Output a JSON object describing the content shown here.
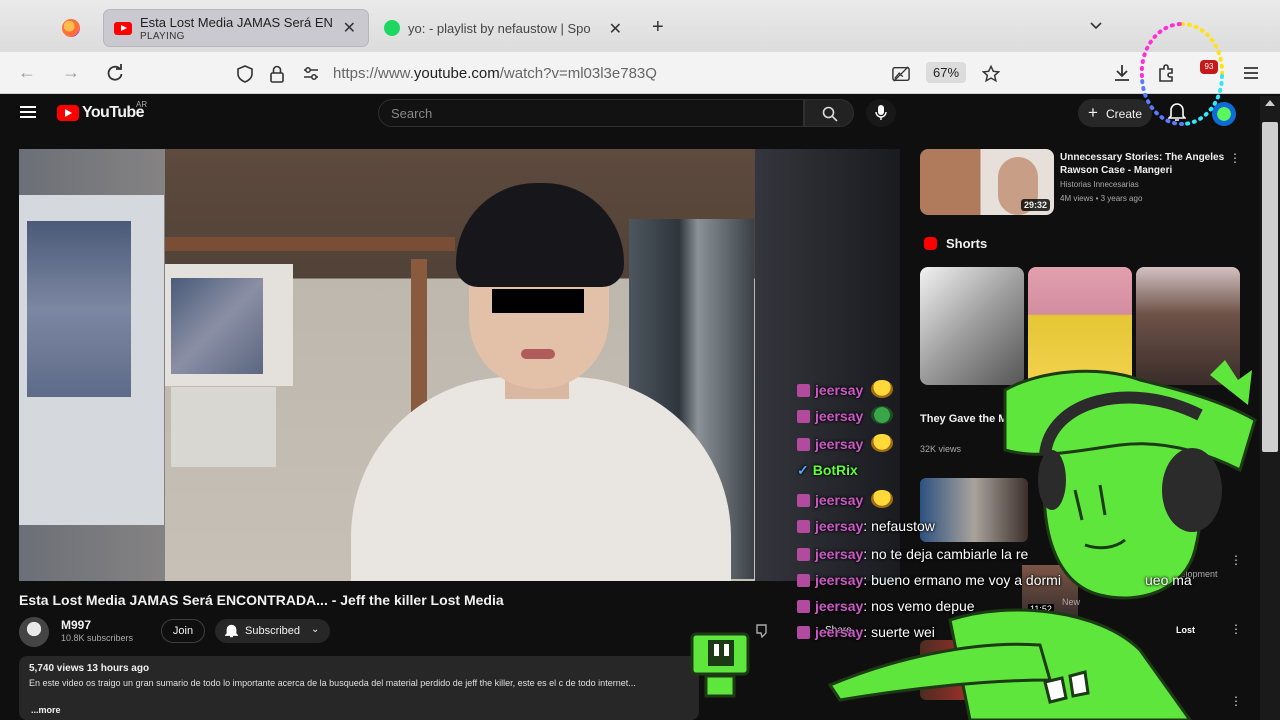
{
  "browser": {
    "tabs": [
      {
        "title": "Esta Lost Media JAMAS Será EN",
        "subtitle": "PLAYING",
        "active": true
      },
      {
        "title": "yo: - playlist by nefaustow | Spo",
        "active": false
      }
    ],
    "url_prefix": "https://www.",
    "url_domain": "youtube.com",
    "url_path": "/watch?v=ml03l3e783Q",
    "zoom": "67%",
    "extension_badge": "93"
  },
  "youtube": {
    "wordmark": "YouTube",
    "country": "AR",
    "search_placeholder": "Search",
    "create_label": "Create"
  },
  "video": {
    "title": "Esta Lost Media JAMAS Será ENCONTRADA... - Jeff the killer Lost Media",
    "channel": "M997",
    "subscribers": "10.8K subscribers",
    "join_label": "Join",
    "subscribed_label": "Subscribed",
    "stats": "5,740 views  13 hours ago",
    "description": "En este video os traigo un gran sumario de todo lo importante acerca de la busqueda del material perdido de jeff the killer, este es el c de todo internet...",
    "more_label": "...more",
    "share_label": "Share"
  },
  "sidebar": {
    "rec1": {
      "title": "Unnecessary Stories: The Angeles Rawson Case - Mangeri",
      "channel": "Historias Innecesarias",
      "meta": "4M views • 3 years ago",
      "duration": "29:32"
    },
    "shorts_label": "Shorts",
    "short_title": "They Gave the Mouse ...",
    "short_views": "32K views",
    "rec_frag_development": "development",
    "rec_frag_lost": "Lost",
    "rec_frag_new": "New",
    "rec_frag_duration": "11:52"
  },
  "chat": {
    "messages": [
      {
        "user": "jeersay",
        "text": ""
      },
      {
        "user": "jeersay",
        "text": ""
      },
      {
        "user": "jeersay",
        "text": ""
      },
      {
        "user": "BotRix",
        "text": ""
      },
      {
        "user": "jeersay",
        "text": ""
      },
      {
        "user": "jeersay",
        "text": "nefaustow"
      },
      {
        "user": "jeersay",
        "text": "no te deja cambiarle la re"
      },
      {
        "user": "jeersay",
        "text": "bueno ermano me voy a dormi"
      },
      {
        "user": "jeersay",
        "text": "nos vemo depue"
      },
      {
        "user": "jeersay",
        "text": "suerte wei"
      }
    ],
    "extra_text": "ueo ma"
  },
  "colors": {
    "youtube_red": "#ff0000",
    "chat_user": "#cf58c8",
    "bot_user": "#5eff3a",
    "mascot_green": "#5fe63c"
  }
}
